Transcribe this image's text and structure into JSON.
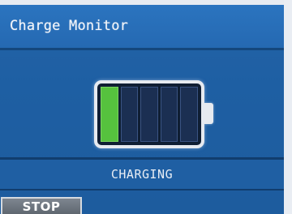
{
  "header": {
    "title": "Charge Monitor"
  },
  "battery": {
    "icon": "battery-icon",
    "total_cells": 5,
    "filled_cells": 1,
    "charge_level": 0.2,
    "fill_color": "#56c23e"
  },
  "status": {
    "text": "CHARGING"
  },
  "controls": {
    "stop_label": "STOP"
  },
  "colors": {
    "background": "#1e5fa3",
    "title_bar": "#2b74bf",
    "button": "#6d757e"
  }
}
